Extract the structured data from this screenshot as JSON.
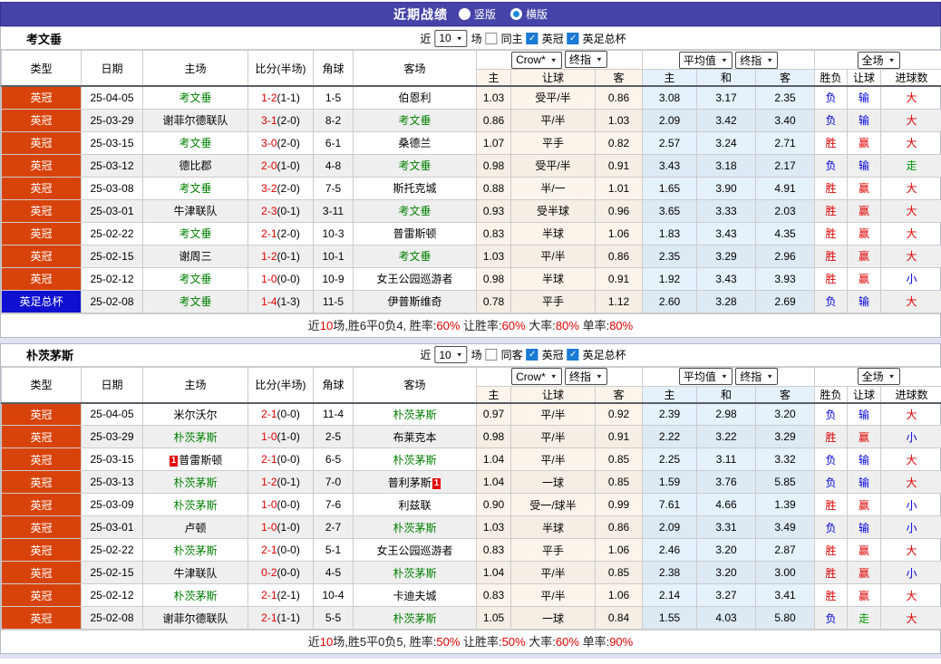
{
  "page": {
    "title": "近期战绩",
    "radios": [
      {
        "label": "竖版",
        "selected": false
      },
      {
        "label": "横版",
        "selected": true
      }
    ]
  },
  "columns": {
    "type": "类型",
    "date": "日期",
    "home": "主场",
    "score": "比分(半场)",
    "corner": "角球",
    "away": "客场",
    "sub1": [
      "主",
      "让球",
      "客"
    ],
    "sub2": [
      "主",
      "和",
      "客"
    ],
    "sub3": [
      "胜负",
      "让球",
      "进球数"
    ]
  },
  "selects": {
    "crow": "Crow*",
    "final1": "终指",
    "avg": "平均值",
    "final2": "终指",
    "full": "全场"
  },
  "sections": [
    {
      "team": "考文垂",
      "filter": {
        "near": "近",
        "count": "10",
        "unit": "场",
        "same_label": "同主",
        "same_checked": false,
        "league_label": "英冠",
        "league_checked": true,
        "cup_label": "英足总杯",
        "cup_checked": true
      },
      "rows": [
        {
          "type": "英冠",
          "cup": false,
          "date": "25-04-05",
          "home": "考文垂",
          "home_hl": true,
          "score": "1-2",
          "half": "(1-1)",
          "corner": "1-5",
          "away": "伯恩利",
          "away_hl": false,
          "crow": [
            "1.03",
            "受平/半",
            "0.86"
          ],
          "avg": [
            "3.08",
            "3.17",
            "2.35"
          ],
          "res": [
            [
              "负",
              "b"
            ],
            [
              "输",
              "b"
            ],
            [
              "大",
              "r"
            ]
          ]
        },
        {
          "type": "英冠",
          "cup": false,
          "date": "25-03-29",
          "home": "谢菲尔德联队",
          "home_hl": false,
          "score": "3-1",
          "half": "(2-0)",
          "corner": "8-2",
          "away": "考文垂",
          "away_hl": true,
          "crow": [
            "0.86",
            "平/半",
            "1.03"
          ],
          "avg": [
            "2.09",
            "3.42",
            "3.40"
          ],
          "res": [
            [
              "负",
              "b"
            ],
            [
              "输",
              "b"
            ],
            [
              "大",
              "r"
            ]
          ]
        },
        {
          "type": "英冠",
          "cup": false,
          "date": "25-03-15",
          "home": "考文垂",
          "home_hl": true,
          "score": "3-0",
          "half": "(2-0)",
          "corner": "6-1",
          "away": "桑德兰",
          "away_hl": false,
          "crow": [
            "1.07",
            "平手",
            "0.82"
          ],
          "avg": [
            "2.57",
            "3.24",
            "2.71"
          ],
          "res": [
            [
              "胜",
              "r"
            ],
            [
              "赢",
              "r"
            ],
            [
              "大",
              "r"
            ]
          ]
        },
        {
          "type": "英冠",
          "cup": false,
          "date": "25-03-12",
          "home": "德比郡",
          "home_hl": false,
          "score": "2-0",
          "half": "(1-0)",
          "corner": "4-8",
          "away": "考文垂",
          "away_hl": true,
          "crow": [
            "0.98",
            "受平/半",
            "0.91"
          ],
          "avg": [
            "3.43",
            "3.18",
            "2.17"
          ],
          "res": [
            [
              "负",
              "b"
            ],
            [
              "输",
              "b"
            ],
            [
              "走",
              "grn"
            ]
          ]
        },
        {
          "type": "英冠",
          "cup": false,
          "date": "25-03-08",
          "home": "考文垂",
          "home_hl": true,
          "score": "3-2",
          "half": "(2-0)",
          "corner": "7-5",
          "away": "斯托克城",
          "away_hl": false,
          "crow": [
            "0.88",
            "半/一",
            "1.01"
          ],
          "avg": [
            "1.65",
            "3.90",
            "4.91"
          ],
          "res": [
            [
              "胜",
              "r"
            ],
            [
              "赢",
              "r"
            ],
            [
              "大",
              "r"
            ]
          ]
        },
        {
          "type": "英冠",
          "cup": false,
          "date": "25-03-01",
          "home": "牛津联队",
          "home_hl": false,
          "score": "2-3",
          "half": "(0-1)",
          "corner": "3-11",
          "away": "考文垂",
          "away_hl": true,
          "crow": [
            "0.93",
            "受半球",
            "0.96"
          ],
          "avg": [
            "3.65",
            "3.33",
            "2.03"
          ],
          "res": [
            [
              "胜",
              "r"
            ],
            [
              "赢",
              "r"
            ],
            [
              "大",
              "r"
            ]
          ]
        },
        {
          "type": "英冠",
          "cup": false,
          "date": "25-02-22",
          "home": "考文垂",
          "home_hl": true,
          "score": "2-1",
          "half": "(2-0)",
          "corner": "10-3",
          "away": "普雷斯顿",
          "away_hl": false,
          "crow": [
            "0.83",
            "半球",
            "1.06"
          ],
          "avg": [
            "1.83",
            "3.43",
            "4.35"
          ],
          "res": [
            [
              "胜",
              "r"
            ],
            [
              "赢",
              "r"
            ],
            [
              "大",
              "r"
            ]
          ]
        },
        {
          "type": "英冠",
          "cup": false,
          "date": "25-02-15",
          "home": "谢周三",
          "home_hl": false,
          "score": "1-2",
          "half": "(0-1)",
          "corner": "10-1",
          "away": "考文垂",
          "away_hl": true,
          "crow": [
            "1.03",
            "平/半",
            "0.86"
          ],
          "avg": [
            "2.35",
            "3.29",
            "2.96"
          ],
          "res": [
            [
              "胜",
              "r"
            ],
            [
              "赢",
              "r"
            ],
            [
              "大",
              "r"
            ]
          ]
        },
        {
          "type": "英冠",
          "cup": false,
          "date": "25-02-12",
          "home": "考文垂",
          "home_hl": true,
          "score": "1-0",
          "half": "(0-0)",
          "corner": "10-9",
          "away": "女王公园巡游者",
          "away_hl": false,
          "crow": [
            "0.98",
            "半球",
            "0.91"
          ],
          "avg": [
            "1.92",
            "3.43",
            "3.93"
          ],
          "res": [
            [
              "胜",
              "r"
            ],
            [
              "赢",
              "r"
            ],
            [
              "小",
              "b"
            ]
          ]
        },
        {
          "type": "英足总杯",
          "cup": true,
          "date": "25-02-08",
          "home": "考文垂",
          "home_hl": true,
          "score": "1-4",
          "half": "(1-3)",
          "corner": "11-5",
          "away": "伊普斯维奇",
          "away_hl": false,
          "crow": [
            "0.78",
            "平手",
            "1.12"
          ],
          "avg": [
            "2.60",
            "3.28",
            "2.69"
          ],
          "res": [
            [
              "负",
              "b"
            ],
            [
              "输",
              "b"
            ],
            [
              "大",
              "r"
            ]
          ]
        }
      ],
      "summary": [
        [
          "近",
          ""
        ],
        [
          "10",
          "r"
        ],
        [
          "场,胜6平0负4, 胜率:",
          ""
        ],
        [
          "60%",
          "r"
        ],
        [
          " 让胜率:",
          ""
        ],
        [
          "60%",
          "r"
        ],
        [
          " 大率:",
          ""
        ],
        [
          "80%",
          "r"
        ],
        [
          " 单率:",
          ""
        ],
        [
          "80%",
          "r"
        ]
      ]
    },
    {
      "team": "朴茨茅斯",
      "filter": {
        "near": "近",
        "count": "10",
        "unit": "场",
        "same_label": "同客",
        "same_checked": false,
        "league_label": "英冠",
        "league_checked": true,
        "cup_label": "英足总杯",
        "cup_checked": true
      },
      "rows": [
        {
          "type": "英冠",
          "cup": false,
          "date": "25-04-05",
          "home": "米尔沃尔",
          "home_hl": false,
          "score": "2-1",
          "half": "(0-0)",
          "corner": "11-4",
          "away": "朴茨茅斯",
          "away_hl": true,
          "crow": [
            "0.97",
            "平/半",
            "0.92"
          ],
          "avg": [
            "2.39",
            "2.98",
            "3.20"
          ],
          "res": [
            [
              "负",
              "b"
            ],
            [
              "输",
              "b"
            ],
            [
              "大",
              "r"
            ]
          ]
        },
        {
          "type": "英冠",
          "cup": false,
          "date": "25-03-29",
          "home": "朴茨茅斯",
          "home_hl": true,
          "score": "1-0",
          "half": "(1-0)",
          "corner": "2-5",
          "away": "布莱克本",
          "away_hl": false,
          "crow": [
            "0.98",
            "平/半",
            "0.91"
          ],
          "avg": [
            "2.22",
            "3.22",
            "3.29"
          ],
          "res": [
            [
              "胜",
              "r"
            ],
            [
              "赢",
              "r"
            ],
            [
              "小",
              "b"
            ]
          ]
        },
        {
          "type": "英冠",
          "cup": false,
          "date": "25-03-15",
          "home": "普雷斯顿",
          "home_hl": false,
          "home_badge": "1",
          "home_badge_pos": "before",
          "score": "2-1",
          "half": "(0-0)",
          "corner": "6-5",
          "away": "朴茨茅斯",
          "away_hl": true,
          "crow": [
            "1.04",
            "平/半",
            "0.85"
          ],
          "avg": [
            "2.25",
            "3.11",
            "3.32"
          ],
          "res": [
            [
              "负",
              "b"
            ],
            [
              "输",
              "b"
            ],
            [
              "大",
              "r"
            ]
          ]
        },
        {
          "type": "英冠",
          "cup": false,
          "date": "25-03-13",
          "home": "朴茨茅斯",
          "home_hl": true,
          "score": "1-2",
          "half": "(0-1)",
          "corner": "7-0",
          "away": "普利茅斯",
          "away_hl": false,
          "away_badge": "1",
          "away_badge_pos": "after",
          "crow": [
            "1.04",
            "一球",
            "0.85"
          ],
          "avg": [
            "1.59",
            "3.76",
            "5.85"
          ],
          "res": [
            [
              "负",
              "b"
            ],
            [
              "输",
              "b"
            ],
            [
              "大",
              "r"
            ]
          ]
        },
        {
          "type": "英冠",
          "cup": false,
          "date": "25-03-09",
          "home": "朴茨茅斯",
          "home_hl": true,
          "score": "1-0",
          "half": "(0-0)",
          "corner": "7-6",
          "away": "利兹联",
          "away_hl": false,
          "crow": [
            "0.90",
            "受一/球半",
            "0.99"
          ],
          "avg": [
            "7.61",
            "4.66",
            "1.39"
          ],
          "res": [
            [
              "胜",
              "r"
            ],
            [
              "赢",
              "r"
            ],
            [
              "小",
              "b"
            ]
          ]
        },
        {
          "type": "英冠",
          "cup": false,
          "date": "25-03-01",
          "home": "卢顿",
          "home_hl": false,
          "score": "1-0",
          "half": "(1-0)",
          "corner": "2-7",
          "away": "朴茨茅斯",
          "away_hl": true,
          "crow": [
            "1.03",
            "半球",
            "0.86"
          ],
          "avg": [
            "2.09",
            "3.31",
            "3.49"
          ],
          "res": [
            [
              "负",
              "b"
            ],
            [
              "输",
              "b"
            ],
            [
              "小",
              "b"
            ]
          ]
        },
        {
          "type": "英冠",
          "cup": false,
          "date": "25-02-22",
          "home": "朴茨茅斯",
          "home_hl": true,
          "score": "2-1",
          "half": "(0-0)",
          "corner": "5-1",
          "away": "女王公园巡游者",
          "away_hl": false,
          "crow": [
            "0.83",
            "平手",
            "1.06"
          ],
          "avg": [
            "2.46",
            "3.20",
            "2.87"
          ],
          "res": [
            [
              "胜",
              "r"
            ],
            [
              "赢",
              "r"
            ],
            [
              "大",
              "r"
            ]
          ]
        },
        {
          "type": "英冠",
          "cup": false,
          "date": "25-02-15",
          "home": "牛津联队",
          "home_hl": false,
          "score": "0-2",
          "half": "(0-0)",
          "corner": "4-5",
          "away": "朴茨茅斯",
          "away_hl": true,
          "crow": [
            "1.04",
            "平/半",
            "0.85"
          ],
          "avg": [
            "2.38",
            "3.20",
            "3.00"
          ],
          "res": [
            [
              "胜",
              "r"
            ],
            [
              "赢",
              "r"
            ],
            [
              "小",
              "b"
            ]
          ]
        },
        {
          "type": "英冠",
          "cup": false,
          "date": "25-02-12",
          "home": "朴茨茅斯",
          "home_hl": true,
          "score": "2-1",
          "half": "(2-1)",
          "corner": "10-4",
          "away": "卡迪夫城",
          "away_hl": false,
          "crow": [
            "0.83",
            "平/半",
            "1.06"
          ],
          "avg": [
            "2.14",
            "3.27",
            "3.41"
          ],
          "res": [
            [
              "胜",
              "r"
            ],
            [
              "赢",
              "r"
            ],
            [
              "大",
              "r"
            ]
          ]
        },
        {
          "type": "英冠",
          "cup": false,
          "date": "25-02-08",
          "home": "谢菲尔德联队",
          "home_hl": false,
          "score": "2-1",
          "half": "(1-1)",
          "corner": "5-5",
          "away": "朴茨茅斯",
          "away_hl": true,
          "crow": [
            "1.05",
            "一球",
            "0.84"
          ],
          "avg": [
            "1.55",
            "4.03",
            "5.80"
          ],
          "res": [
            [
              "负",
              "b"
            ],
            [
              "走",
              "grn"
            ],
            [
              "大",
              "r"
            ]
          ]
        }
      ],
      "summary": [
        [
          "近",
          ""
        ],
        [
          "10",
          "r"
        ],
        [
          "场,胜5平0负5, 胜率:",
          ""
        ],
        [
          "50%",
          "r"
        ],
        [
          " 让胜率:",
          ""
        ],
        [
          "50%",
          "r"
        ],
        [
          " 大率:",
          ""
        ],
        [
          "60%",
          "r"
        ],
        [
          " 单率:",
          ""
        ],
        [
          "90%",
          "r"
        ]
      ]
    }
  ]
}
